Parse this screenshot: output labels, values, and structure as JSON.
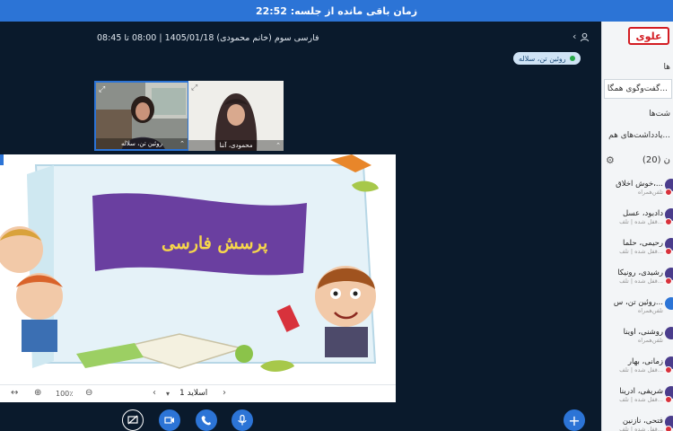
{
  "timer": {
    "text": "زمان باقی مانده از جلسه: 22:52"
  },
  "meeting": {
    "title": "فارسی سوم (خانم محمودی) 1405/01/18 | 08:00 تا 08:45"
  },
  "presenter_label": "روئین تن، سلاله",
  "logo_text": "علوی",
  "sidebar": {
    "items": [
      {
        "label": "ها"
      },
      {
        "label": "گفت‌وگوی همگا..."
      },
      {
        "label": "شت‌ها"
      },
      {
        "label": "یادداشت‌های هم..."
      }
    ],
    "users_header": "ن (20)"
  },
  "users": [
    {
      "name": "خوش اخلاق،...",
      "role": "تلفن‌همراه"
    },
    {
      "name": "دادبود، عسل",
      "role": "قفل شده | تلف..."
    },
    {
      "name": "رحیمی، حلما",
      "role": "قفل شده | تلف..."
    },
    {
      "name": "رشیدی، رونیکا",
      "role": "قفل شده | تلف..."
    },
    {
      "name": "روئین تن، س...",
      "role": "تلفن‌همراه"
    },
    {
      "name": "روشنی، آوینا",
      "role": "تلفن‌همراه"
    },
    {
      "name": "زمانی، بهار",
      "role": "قفل شده | تلف..."
    },
    {
      "name": "شریفی، آدرینا",
      "role": "قفل شده | تلف..."
    },
    {
      "name": "فتحی، نازنین",
      "role": "قفل شده | تلف..."
    }
  ],
  "videos": [
    {
      "name": "روئین تن، سلاله"
    },
    {
      "name": "محمودی، آتنا"
    }
  ],
  "slide": {
    "title": "پرسش فارسی",
    "nav_label": "اسلاید 1",
    "zoom": "100٪"
  },
  "colors": {
    "primary": "#2c74d6",
    "dark_bg": "#0a1a2c",
    "banner": "#6a3fa0",
    "title_yellow": "#f6d64b"
  },
  "icons": {
    "mic": "mic-icon",
    "phone": "phone-icon",
    "camera": "camera-icon",
    "screen": "screen-share-icon",
    "plus": "plus-icon",
    "gear": "gear-icon"
  }
}
